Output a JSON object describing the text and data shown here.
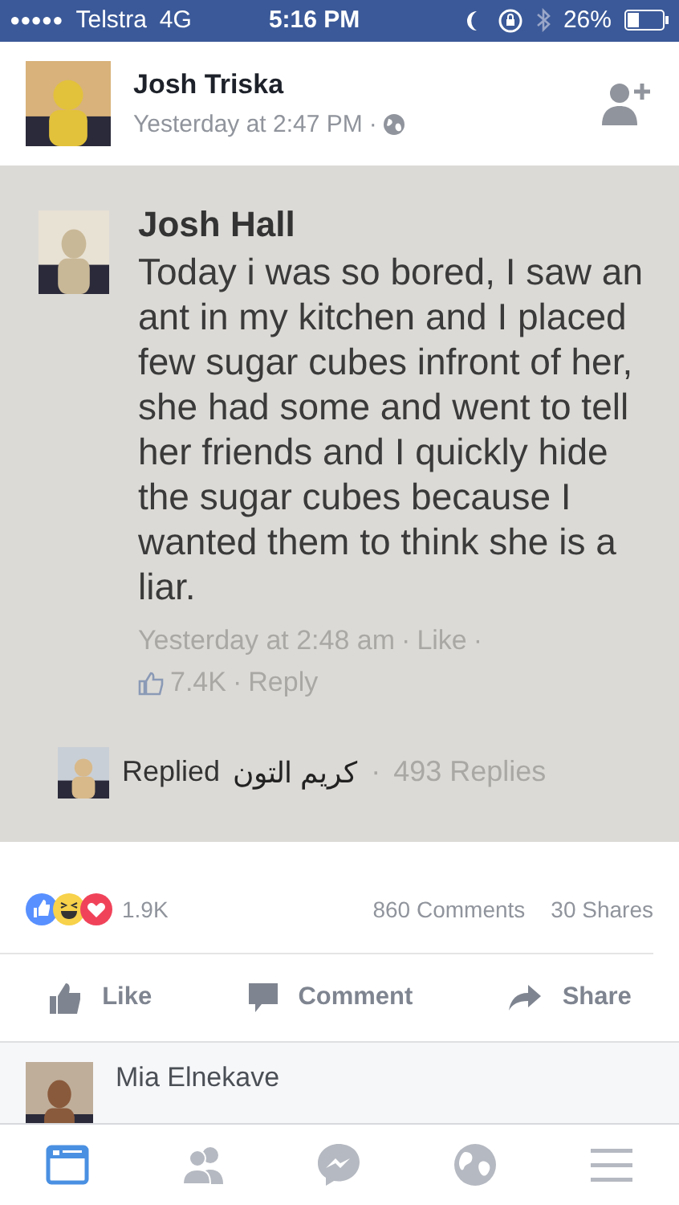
{
  "status_bar": {
    "signal": "●●●●●",
    "carrier": "Telstra",
    "network": "4G",
    "time": "5:16 PM",
    "battery": "26%"
  },
  "post": {
    "author": "Josh Triska",
    "time": "Yesterday at 2:47 PM",
    "separator": "·"
  },
  "shared_comment": {
    "author": "Josh Hall",
    "text": "Today i was so bored, I saw an ant in my kitchen and I placed few sugar cubes infront of her, she had some and went to tell her friends and I quickly hide the sugar cubes because I wanted them to think she is a liar.",
    "time": "Yesterday at 2:48 am",
    "like": "Like",
    "separator": "·",
    "likes": "7.4K",
    "reply": "Reply",
    "replied_label": "Replied",
    "replied_name": "كريم التون",
    "replies": "493 Replies"
  },
  "stats": {
    "reactions": [
      {
        "kind": "like"
      },
      {
        "kind": "haha"
      },
      {
        "kind": "love"
      }
    ],
    "reaction_count": "1.9K",
    "comments": "860 Comments",
    "shares": "30 Shares"
  },
  "actions": [
    {
      "kind": "like",
      "label": "Like"
    },
    {
      "kind": "comment",
      "label": "Comment"
    },
    {
      "kind": "share",
      "label": "Share"
    }
  ],
  "comment_preview": {
    "author": "Mia Elnekave"
  },
  "tab_bar": [
    {
      "kind": "feed",
      "selected": true
    },
    {
      "kind": "friends",
      "selected": false
    },
    {
      "kind": "messenger",
      "selected": false
    },
    {
      "kind": "globe",
      "selected": false
    },
    {
      "kind": "menu",
      "selected": false
    }
  ]
}
